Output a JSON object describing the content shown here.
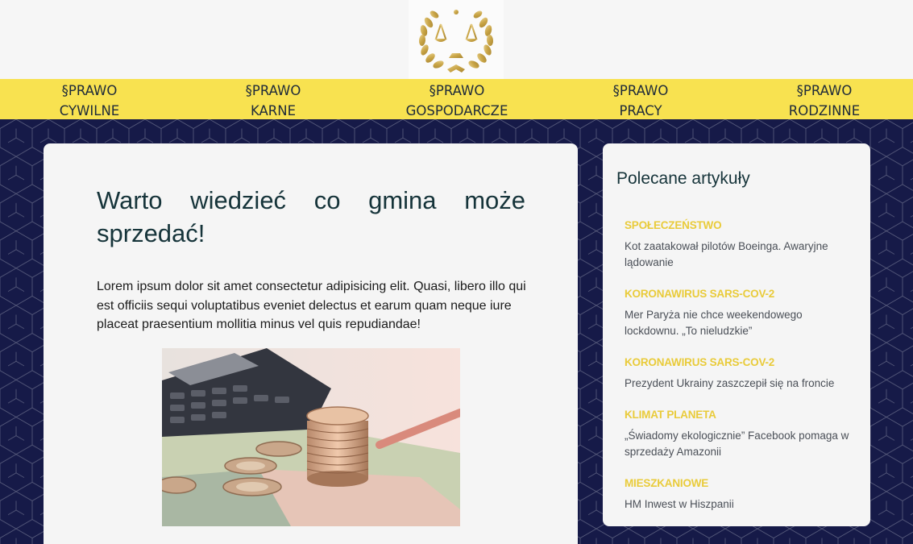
{
  "nav": {
    "items": [
      {
        "line1": "§PRAWO",
        "line2": "CYWILNE"
      },
      {
        "line1": "§PRAWO",
        "line2": "KARNE"
      },
      {
        "line1": "§PRAWO",
        "line2": "GOSPODARCZE"
      },
      {
        "line1": "§PRAWO",
        "line2": "PRACY"
      },
      {
        "line1": "§PRAWO",
        "line2": "RODZINNE"
      }
    ]
  },
  "article": {
    "title": "Warto wiedzieć co gmina może sprzedać!",
    "body": "Lorem ipsum dolor sit amet consectetur adipisicing elit. Quasi, libero illo qui est officiis sequi voluptatibus eveniet delectus et earum quam neque iure placeat praesentium mollitia minus vel quis repudiandae!"
  },
  "sidebar": {
    "title": "Polecane artykuły",
    "items": [
      {
        "category": "SPOŁECZEŃSTWO",
        "title": "Kot zaatakował pilotów Boeinga. Awaryjne lądowanie"
      },
      {
        "category": "KORONAWIRUS SARS-COV-2",
        "title": "Mer Paryża nie chce weekendowego lockdownu. „To nieludzkie”"
      },
      {
        "category": "KORONAWIRUS SARS-COV-2",
        "title": "Prezydent Ukrainy zaszczepił się na froncie"
      },
      {
        "category": "KLIMAT PLANETA",
        "title": "„Świadomy ekologicznie” Facebook pomaga w sprzedaży Amazonii"
      },
      {
        "category": "MIESZKANIOWE",
        "title": "HM Inwest w Hiszpanii"
      }
    ]
  },
  "colors": {
    "nav_bg": "#f8e250",
    "page_bg": "#161a48",
    "category": "#e9cb3a",
    "title": "#16343a"
  },
  "icons": {
    "logo": "scales-of-justice-laurel-icon"
  }
}
